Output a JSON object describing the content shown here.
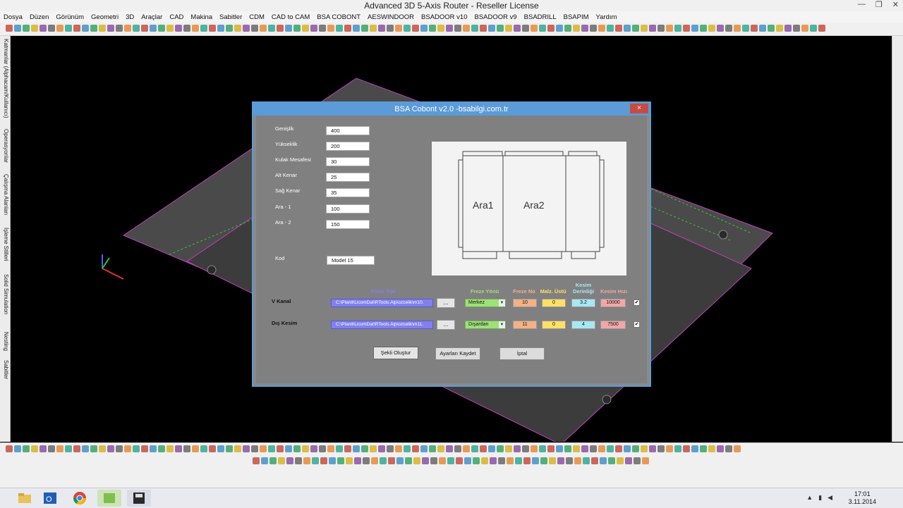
{
  "window": {
    "title": "Advanced 3D 5-Axis Router - Reseller License"
  },
  "menu": [
    "Dosya",
    "Düzen",
    "Görünüm",
    "Geometri",
    "3D",
    "Araçlar",
    "CAD",
    "Makina",
    "Sabitler",
    "CDM",
    "CAD to CAM",
    "BSA COBONT",
    "AESWINDOOR",
    "BSADOOR v10",
    "BSADOOR v9",
    "BSADRILL",
    "BSAPIM",
    "Yardım"
  ],
  "left_tabs": [
    "Katmanlar (Alphacam/Kullanıcı)",
    "Operasyonlar",
    "Çalışma Alanları",
    "İşleme Stilleri",
    "Solid Simulation",
    "Nesting",
    "Sabitler"
  ],
  "dialog": {
    "title": "BSA Cobont v2.0 -bsabilgi.com.tr",
    "close": "×",
    "fields": [
      {
        "label": "Genişlik",
        "value": "400"
      },
      {
        "label": "Yükseklik",
        "value": "200"
      },
      {
        "label": "Kulak Mesafesi",
        "value": "30"
      },
      {
        "label": "Alt Kenar",
        "value": "25"
      },
      {
        "label": "Sağ Kenar",
        "value": "35"
      },
      {
        "label": "Ara - 1",
        "value": "100"
      },
      {
        "label": "Ara - 2",
        "value": "150"
      }
    ],
    "kod": {
      "label": "Kod",
      "value": "Model 15"
    },
    "preview": {
      "ara1": "Ara1",
      "ara2": "Ara2"
    },
    "columns": {
      "tool_type": "Freze Tipi",
      "direction": "Freze Yönü",
      "tool_no": "Freze No",
      "material_top": "Malz. Üstü",
      "cut_depth": "Kesim Derinliği",
      "cut_speed": "Kesim Hızı"
    },
    "rows": [
      {
        "label": "V Kanal",
        "path": "C:\\Planit\\LicomDat\\RTools.Alp\\ozcelik\\m10.",
        "browse": "...",
        "direction": "Merkez",
        "tool_no": "10",
        "material_top": "0",
        "cut_depth": "3.2",
        "cut_speed": "10000",
        "checked": "✔"
      },
      {
        "label": "Dış Kesim",
        "path": "C:\\Planit\\LicomDat\\RTools.Alp\\ozcelik\\m11.",
        "browse": "...",
        "direction": "Dışardan",
        "tool_no": "11",
        "material_top": "0",
        "cut_depth": "4",
        "cut_speed": "7500",
        "checked": "✔"
      }
    ],
    "buttons": {
      "create": "Şekli Oluştur",
      "save": "Ayarları Kaydet",
      "cancel": "İptal"
    }
  },
  "taskbar": {
    "time": "17:01",
    "date": "3.11.2014"
  },
  "colors": {
    "dialog_border": "#5a9bd8",
    "col_tool_type": "#8080f0",
    "col_direction": "#9ee07a",
    "col_tool_no": "#f4b183",
    "col_material": "#ffe066",
    "col_depth": "#a6e8f4",
    "col_speed": "#f4a6a6"
  }
}
